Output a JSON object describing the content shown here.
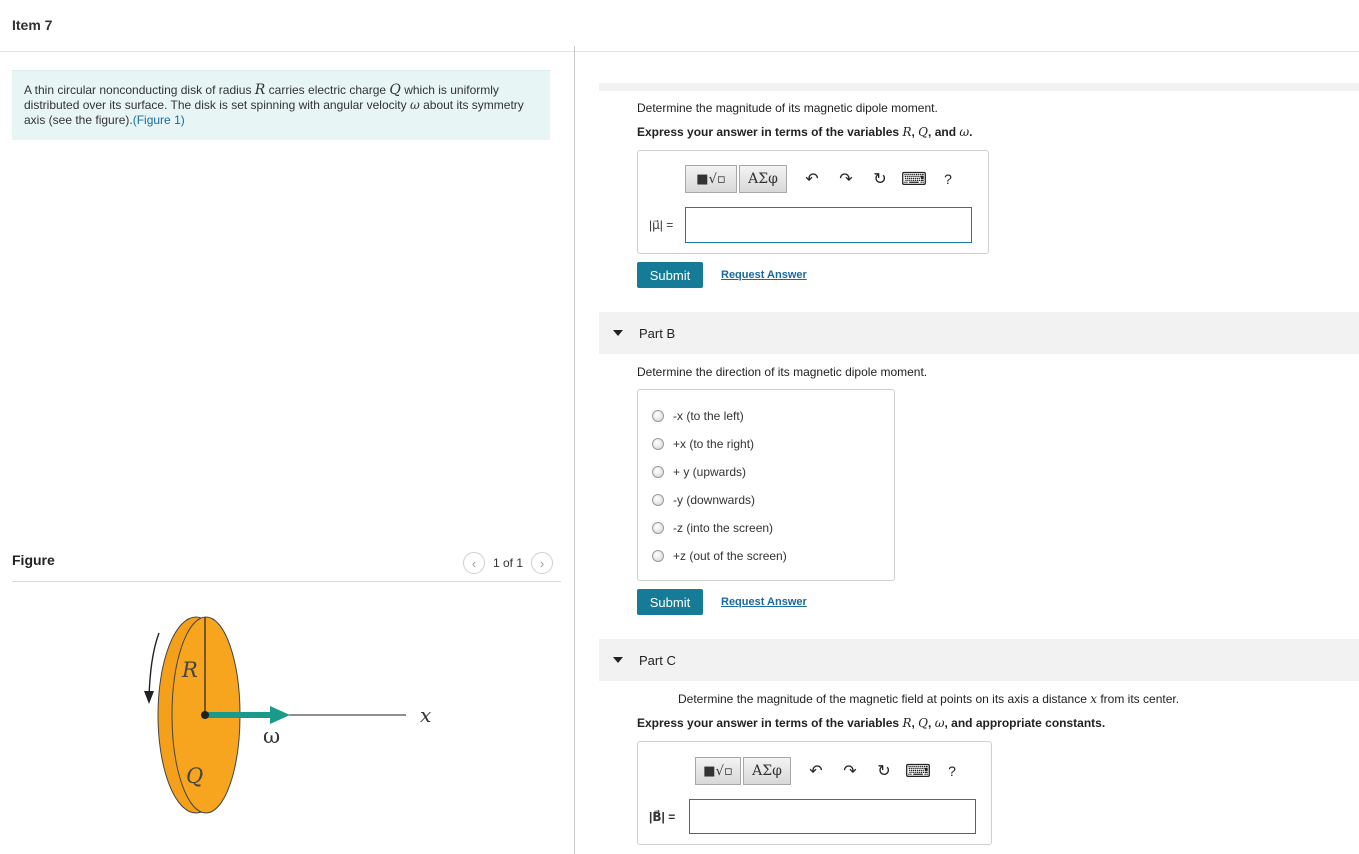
{
  "item": {
    "title": "Item 7"
  },
  "problem": {
    "line1_a": "A thin circular nonconducting disk of radius ",
    "var_R": "R",
    "line1_b": " carries electric charge ",
    "var_Q": "Q",
    "line1_c": " which is uniformly",
    "line2_a": "distributed over its surface. The disk is set spinning with angular velocity ",
    "var_w": "ω",
    "line2_b": " about its symmetry",
    "line3": "axis (see the figure).",
    "figure_link": "(Figure 1)"
  },
  "figure_panel": {
    "label": "Figure",
    "pager": {
      "prev_icon": "chevron-left-icon",
      "next_icon": "chevron-right-icon",
      "count": "1 of 1"
    },
    "diagram": {
      "label_R": "R",
      "label_Q": "Q",
      "label_w": "ω",
      "label_x": "x",
      "disk_color": "#f5a01a",
      "arrow_color": "#1a9a8a"
    }
  },
  "part_a": {
    "prompt": "Determine the magnitude of its magnetic dipole moment.",
    "express_prefix": "Express your answer in terms of the variables ",
    "vars": [
      "R",
      "Q"
    ],
    "and_word": "and",
    "last_var": "ω",
    "answer_label": "|μ⃗| =",
    "toolbar": {
      "templates": "■√▫",
      "greek": "ΑΣφ",
      "undo": "↶",
      "redo": "↷",
      "reset": "↻",
      "keyboard": "⌨",
      "help": "?"
    },
    "submit": "Submit",
    "request": "Request Answer"
  },
  "part_b": {
    "title": "Part B",
    "prompt": "Determine the direction of its magnetic dipole moment.",
    "options": [
      "-x (to the left)",
      "+x (to the right)",
      "+ y (upwards)",
      "-y (downwards)",
      "-z (into the screen)",
      "+z (out of the screen)"
    ],
    "submit": "Submit",
    "request": "Request Answer"
  },
  "part_c": {
    "title": "Part C",
    "prompt_a": "Determine the magnitude of the magnetic field at points on its axis a distance ",
    "prompt_var": "x",
    "prompt_b": " from its center.",
    "express_prefix": "Express your answer in terms of the variables ",
    "vars": [
      "R",
      "Q",
      "ω"
    ],
    "express_suffix": "and appropriate constants.",
    "answer_label": "|B⃗| =",
    "toolbar": {
      "templates": "■√▫",
      "greek": "ΑΣφ",
      "undo": "↶",
      "redo": "↷",
      "reset": "↻",
      "keyboard": "⌨",
      "help": "?"
    }
  }
}
